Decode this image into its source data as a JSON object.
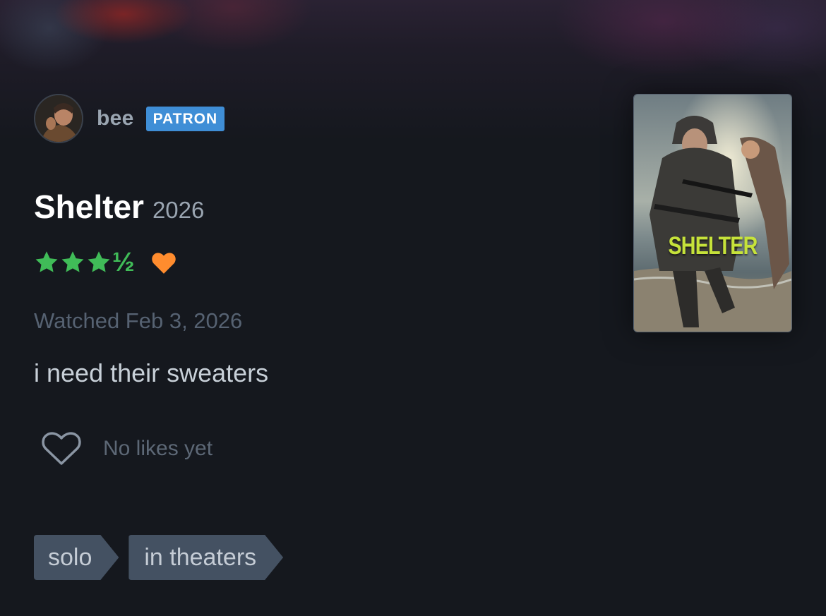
{
  "author": {
    "username": "bee",
    "badge": "PATRON",
    "avatar_icon": "avatar-image"
  },
  "film": {
    "title": "Shelter",
    "year": "2026",
    "poster_title": "SHELTER"
  },
  "rating": {
    "stars": 3.5,
    "half_glyph": "½",
    "liked": true,
    "star_color": "#40bc58",
    "heart_color": "#ff8c2e"
  },
  "watched": "Watched Feb 3, 2026",
  "review_text": "i need their sweaters",
  "likes": {
    "text": "No likes yet",
    "icon": "heart-outline-icon"
  },
  "tags": [
    "solo",
    "in theaters"
  ],
  "colors": {
    "background": "#15181e",
    "patron_badge": "#3f8ed6",
    "tag_background": "#445162"
  }
}
